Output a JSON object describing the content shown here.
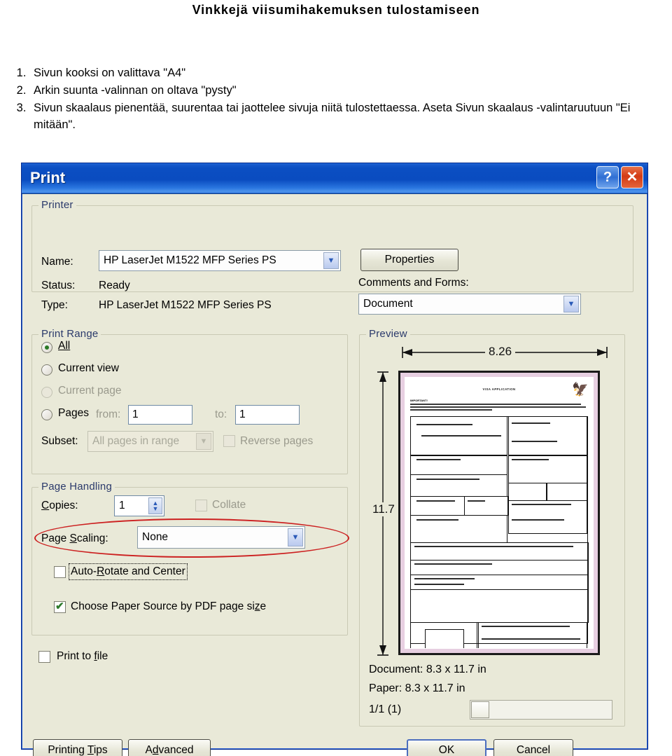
{
  "document": {
    "title": "Vinkkejä viisumihakemuksen tulostamiseen",
    "instructions": [
      "Sivun kooksi on valittava \"A4\"",
      "Arkin suunta -valinnan on oltava \"pysty\"",
      "Sivun skaalaus pienentää, suurentaa tai jaottelee sivuja niitä tulostettaessa. Aseta Sivun skaalaus -valintaruutuun \"Ei mitään\"."
    ]
  },
  "dialog": {
    "title": "Print",
    "help_button": "?",
    "close_button": "✕",
    "printer": {
      "legend": "Printer",
      "name_label": "Name:",
      "name_value": "HP LaserJet M1522 MFP Series PS",
      "properties_button": "Properties",
      "status_label": "Status:",
      "status_value": "Ready",
      "type_label": "Type:",
      "type_value": "HP LaserJet M1522 MFP Series PS",
      "comments_label": "Comments and Forms:",
      "comments_value": "Document"
    },
    "print_range": {
      "legend": "Print Range",
      "all_label": "All",
      "current_view_label": "Current view",
      "current_page_label": "Current page",
      "pages_label": "Pages",
      "from_label": "from:",
      "from_value": "1",
      "to_label": "to:",
      "to_value": "1",
      "subset_label": "Subset:",
      "subset_value": "All pages in range",
      "reverse_label": "Reverse pages"
    },
    "page_handling": {
      "legend": "Page Handling",
      "copies_label": "Copies:",
      "copies_value": "1",
      "collate_label": "Collate",
      "page_scaling_label": "Page Scaling:",
      "page_scaling_value": "None",
      "auto_rotate_label": "Auto-Rotate and Center",
      "choose_paper_label": "Choose Paper Source by PDF page size"
    },
    "print_to_file_label": "Print to file",
    "preview": {
      "legend": "Preview",
      "width_dim": "8.26",
      "height_dim": "11.7",
      "document_size": "Document: 8.3 x 11.7 in",
      "paper_size": "Paper: 8.3 x 11.7 in",
      "page_counter": "1/1 (1)",
      "page_title": "VISA APPLICATION",
      "important_label": "IMPORTANT!",
      "crest_icon": "crest-icon"
    },
    "buttons": {
      "printing_tips": "Printing Tips",
      "advanced": "Advanced",
      "ok": "OK",
      "cancel": "Cancel"
    }
  },
  "colors": {
    "titlebar_blue": "#0b4ec2",
    "dialog_face": "#e9e9d8",
    "annotation_red": "#cc2020",
    "close_red": "#d33b15",
    "group_legend": "#2b3a6b"
  }
}
